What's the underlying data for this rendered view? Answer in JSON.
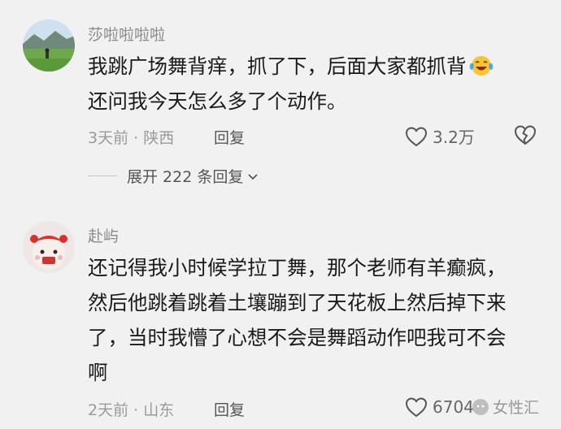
{
  "comments": [
    {
      "username": "莎啦啦啦啦",
      "lines": [
        "我跳广场舞背痒，抓了下，后面大家都抓背",
        "还问我今天怎么多了个动作。"
      ],
      "emoji_icon": "laughing-crying-emoji",
      "time_location": "3天前 · 陕西",
      "reply_label": "回复",
      "likes": "3.2万",
      "expand_label": "展开 222 条回复"
    },
    {
      "username": "赴屿",
      "lines": [
        "还记得我小时候学拉丁舞，那个老师有羊癫疯，",
        "然后他跳着跳着土壤蹦到了天花板上然后掉下来",
        "了，当时我懵了心想不会是舞蹈动作吧我可不会",
        "啊"
      ],
      "time_location": "2天前 · 山东",
      "reply_label": "回复",
      "likes": "6704"
    }
  ],
  "watermark": "女性汇",
  "colors": {
    "background": "#f1f1f1",
    "username": "#8a8a8a",
    "meta": "#9a9a9a"
  }
}
